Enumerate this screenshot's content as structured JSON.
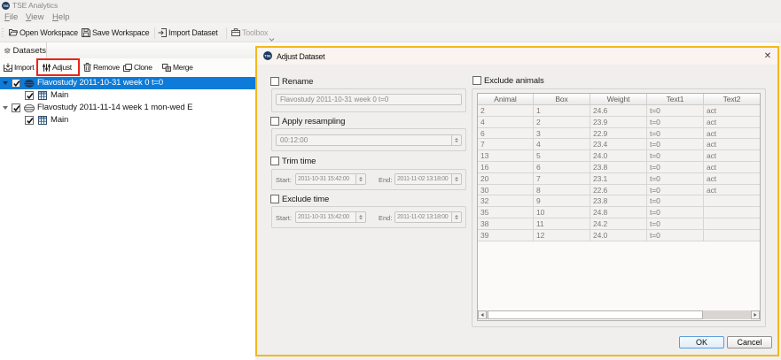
{
  "window": {
    "title": "TSE Analytics"
  },
  "menu": {
    "items": [
      "File",
      "View",
      "Help"
    ]
  },
  "toolbar": {
    "open_workspace": "Open Workspace",
    "save_workspace": "Save Workspace",
    "import_dataset": "Import Dataset",
    "toolbox": "Toolbox"
  },
  "dock": {
    "tab": "Datasets",
    "toolbar": {
      "import": "Import",
      "adjust": "Adjust",
      "remove": "Remove",
      "clone": "Clone",
      "merge": "Merge"
    },
    "tree": [
      {
        "label": "Flavostudy 2011-10-31 week 0 t=0",
        "level": 0,
        "checked": true,
        "expanded": true,
        "selected": true
      },
      {
        "label": "Main",
        "level": 1,
        "checked": true
      },
      {
        "label": "Flavostudy 2011-11-14 week 1 mon-wed E",
        "level": 0,
        "checked": true,
        "expanded": true
      },
      {
        "label": "Main",
        "level": 1,
        "checked": true
      }
    ]
  },
  "dialog": {
    "title": "Adjust Dataset",
    "close_glyph": "✕",
    "rename": {
      "label": "Rename",
      "checked": false,
      "value": "Flavostudy 2011-10-31 week 0 t=0"
    },
    "resampling": {
      "label": "Apply resampling",
      "checked": false,
      "value": "00:12:00"
    },
    "trim": {
      "label": "Trim time",
      "checked": false,
      "start_label": "Start:",
      "start": "2011-10-31 15:42:00",
      "end_label": "End:",
      "end": "2011-11-02 13:18:00"
    },
    "exclude_time": {
      "label": "Exclude time",
      "checked": false,
      "start_label": "Start:",
      "start": "2011-10-31 15:42:00",
      "end_label": "End:",
      "end": "2011-11-02 13:18:00"
    },
    "exclude_animals": {
      "label": "Exclude animals",
      "checked": false
    },
    "table": {
      "columns": [
        "Animal",
        "Box",
        "Weight",
        "Text1",
        "Text2"
      ],
      "rows": [
        [
          "2",
          "1",
          "24.6",
          "t=0",
          "act"
        ],
        [
          "4",
          "2",
          "23.9",
          "t=0",
          "act"
        ],
        [
          "6",
          "3",
          "22.9",
          "t=0",
          "act"
        ],
        [
          "7",
          "4",
          "23.4",
          "t=0",
          "act"
        ],
        [
          "13",
          "5",
          "24.0",
          "t=0",
          "act"
        ],
        [
          "16",
          "6",
          "23.8",
          "t=0",
          "act"
        ],
        [
          "20",
          "7",
          "23.1",
          "t=0",
          "act"
        ],
        [
          "30",
          "8",
          "22.6",
          "t=0",
          "act"
        ],
        [
          "32",
          "9",
          "23.8",
          "t=0",
          ""
        ],
        [
          "35",
          "10",
          "24.8",
          "t=0",
          ""
        ],
        [
          "38",
          "11",
          "24.2",
          "t=0",
          ""
        ],
        [
          "39",
          "12",
          "24.0",
          "t=0",
          ""
        ]
      ]
    },
    "buttons": {
      "ok": "OK",
      "cancel": "Cancel"
    }
  },
  "colors": {
    "selection": "#0d7bd7",
    "dialog_border": "#f2b81e",
    "annotation_red": "#e8241a",
    "title_bg": "#f0efee",
    "dialog_title_bg": "#fbf3f0"
  }
}
